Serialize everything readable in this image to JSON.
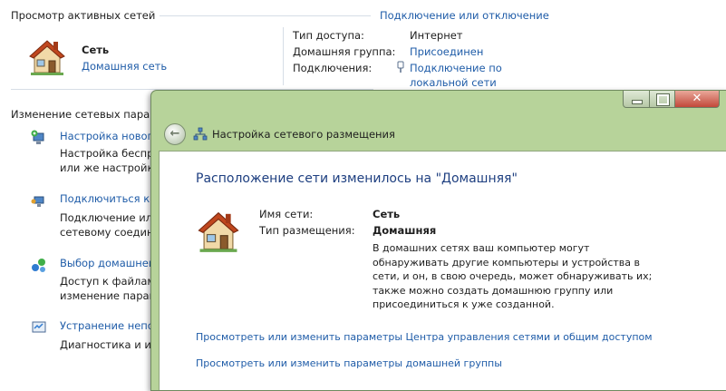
{
  "bg": {
    "active_networks_title": "Просмотр активных сетей",
    "connect_disconnect_link": "Подключение или отключение",
    "network_name": "Сеть",
    "network_type_link": "Домашняя сеть",
    "access_type_label": "Тип доступа:",
    "access_type_value": "Интернет",
    "homegroup_label": "Домашняя группа:",
    "homegroup_value": "Присоединен",
    "connections_label": "Подключения:",
    "connections_value_line1": "Подключение по",
    "connections_value_line2": "локальной сети",
    "change_settings_title": "Изменение сетевых параметр",
    "tasks": [
      {
        "title": "Настройка нового",
        "desc1": "Настройка беспро",
        "desc2": "или же настройка"
      },
      {
        "title": "Подключиться к с",
        "desc1": "Подключение или",
        "desc2": "сетевому соедине"
      },
      {
        "title": "Выбор домашней",
        "desc1": "Доступ к файлам и",
        "desc2": "изменение параме"
      },
      {
        "title": "Устранение непол",
        "desc1": "Диагностика и испр",
        "desc2": ""
      }
    ]
  },
  "dialog": {
    "title": "Настройка сетевого размещения",
    "heading": "Расположение сети изменилось на \"Домашняя\"",
    "name_label": "Имя сети:",
    "name_value": "Сеть",
    "location_label": "Тип размещения:",
    "location_value": "Домашняя",
    "description": [
      "В домашних сетях ваш компьютер могут",
      "обнаруживать другие компьютеры и устройства в",
      "сети, и он, в свою очередь, может обнаруживать их;",
      "также можно создать домашнюю группу или",
      "присоединиться к уже созданной."
    ],
    "link_network_center": "Просмотреть или изменить параметры Центра управления сетями и общим доступом",
    "link_homegroup": "Просмотреть или изменить параметры домашней группы"
  },
  "colors": {
    "link": "#1f5ca8",
    "heading": "#1e3f80",
    "glass": "#b7d39a"
  }
}
